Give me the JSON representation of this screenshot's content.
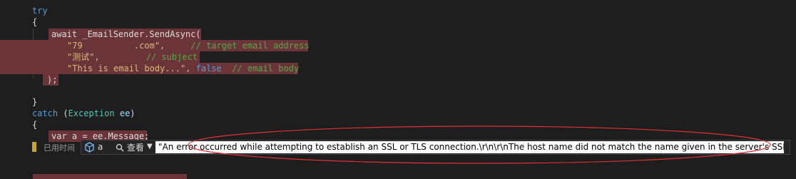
{
  "code": {
    "try_kw": "try",
    "open_brace_1": "{",
    "line_await": "await _EmailSender.SendAsync(",
    "arg_email_str": "\"79",
    "arg_email_rest": "          .com\",",
    "arg_email_comment": "// target email address",
    "arg_subject_str": "\"测试\",",
    "arg_subject_comment": "// subject",
    "arg_body_str": "\"This is email body...\",",
    "arg_body_false": "false",
    "arg_body_comment": "// email body",
    "close_paren": ");",
    "close_brace_1": "}",
    "catch_kw": "catch",
    "exception_type": "Exception",
    "exception_var": "ee",
    "open_brace_2": "{",
    "line_var": "var a = ee.Message;"
  },
  "datatip": {
    "elapsed_label": "已用时间",
    "var_name": "a",
    "view_label": "查看",
    "value": "\"An error occurred while attempting to establish an SSL or TLS connection.\\r\\n\\r\\nThe host name did not match the name given in the server's SSL certificate.\\r\\n\""
  },
  "colors": {
    "background": "#1e1e1e",
    "highlight": "#6a3438",
    "annotation": "#e03030"
  },
  "icons": [
    "watch-variable-icon",
    "magnifier-icon",
    "dropdown-caret-icon"
  ]
}
